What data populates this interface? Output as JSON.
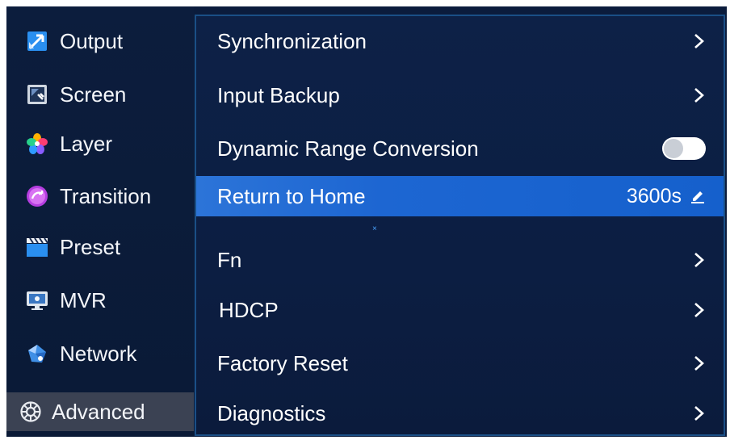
{
  "sidebar": {
    "items": [
      {
        "label": "Output",
        "icon": "output-icon"
      },
      {
        "label": "Screen",
        "icon": "screen-icon"
      },
      {
        "label": "Layer",
        "icon": "layer-icon"
      },
      {
        "label": "Transition",
        "icon": "transition-icon"
      },
      {
        "label": "Preset",
        "icon": "preset-icon"
      },
      {
        "label": "MVR",
        "icon": "mvr-icon"
      },
      {
        "label": "Network",
        "icon": "network-icon"
      },
      {
        "label": "Advanced",
        "icon": "gear-icon",
        "active": true
      }
    ]
  },
  "main": {
    "rows": [
      {
        "label": "Synchronization",
        "control": "chevron-right-icon"
      },
      {
        "label": "Input Backup",
        "control": "chevron-right-icon"
      },
      {
        "label": "Dynamic Range Conversion",
        "control": "toggle",
        "toggle_on": false
      },
      {
        "label": "Return to Home",
        "value": "3600s",
        "control": "edit-icon",
        "selected": true
      },
      {
        "label": "Fn",
        "control": "chevron-right-icon"
      },
      {
        "label": "HDCP",
        "control": "chevron-right-icon"
      },
      {
        "label": "Factory Reset",
        "control": "chevron-right-icon"
      },
      {
        "label": "Diagnostics",
        "control": "chevron-right-icon"
      }
    ],
    "cursor_mark": "×"
  },
  "colors": {
    "background": "#0b1c3c",
    "selected_row": "#1d66d2",
    "active_sidebar": "#3b4253",
    "panel_border": "#1a4f86"
  }
}
